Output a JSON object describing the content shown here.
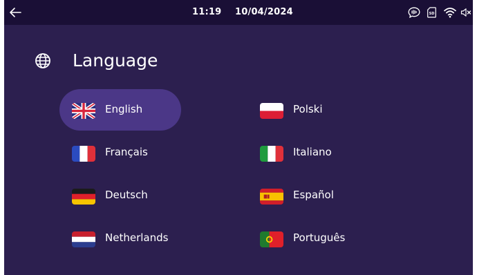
{
  "status_bar": {
    "time": "11:19",
    "date": "10/04/2024",
    "icons": [
      "back-arrow-icon",
      "voice-bubble-icon",
      "sd-card-icon",
      "wifi-icon",
      "speaker-muted-icon"
    ]
  },
  "header": {
    "icon": "globe-icon",
    "title": "Language"
  },
  "languages": [
    {
      "label": "English",
      "flag": "uk-flag-icon",
      "selected": true
    },
    {
      "label": "Français",
      "flag": "france-flag-icon",
      "selected": false
    },
    {
      "label": "Deutsch",
      "flag": "germany-flag-icon",
      "selected": false
    },
    {
      "label": "Netherlands",
      "flag": "netherlands-flag-icon",
      "selected": false
    },
    {
      "label": "Polski",
      "flag": "poland-flag-icon",
      "selected": false
    },
    {
      "label": "Italiano",
      "flag": "italy-flag-icon",
      "selected": false
    },
    {
      "label": "Español",
      "flag": "spain-flag-icon",
      "selected": false
    },
    {
      "label": "Português",
      "flag": "portugal-flag-icon",
      "selected": false
    }
  ],
  "colors": {
    "background": "#2c1f4f",
    "status_bar": "#1a0f36",
    "selected_item": "#4b3787",
    "text": "#ffffff"
  }
}
